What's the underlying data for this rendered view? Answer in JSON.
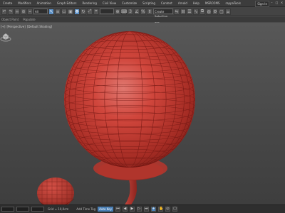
{
  "menubar": {
    "items": [
      "Create",
      "Modifiers",
      "Animation",
      "Graph Editors",
      "Rendering",
      "Civil View",
      "Customize",
      "Scripting",
      "Content",
      "Arnold",
      "Help",
      "MSRCOMS",
      "rappaTools"
    ],
    "sign_in": "Sign In",
    "window_controls": [
      "–",
      "□",
      "×"
    ]
  },
  "toolbar": {
    "selection_filter": "All",
    "named_set": "Create Selection Set"
  },
  "subbar": {
    "items": [
      "Object Paint",
      "Populate"
    ]
  },
  "viewport": {
    "labels": [
      "[+]",
      "[Perspective]",
      "[Default Shading]"
    ],
    "object_color": "#c8463d",
    "background": "#4c4c4c"
  },
  "status": {
    "x": "",
    "y": "",
    "z": "",
    "grid": "Grid = 10,0cm",
    "add_time_tag": "Add Time Tag",
    "auto_key": "Auto Key"
  }
}
